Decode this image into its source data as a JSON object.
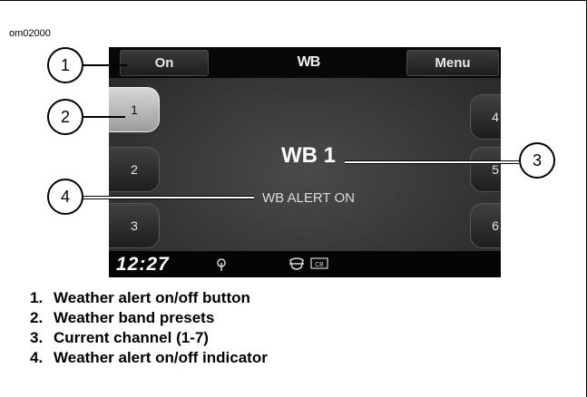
{
  "figure": {
    "id": "om02000"
  },
  "screen": {
    "on_button": "On",
    "title": "WB",
    "menu_button": "Menu",
    "presets_left": [
      {
        "label": "1",
        "active": true
      },
      {
        "label": "2",
        "active": false
      },
      {
        "label": "3",
        "active": false
      }
    ],
    "presets_right": [
      {
        "label": "4"
      },
      {
        "label": "5"
      },
      {
        "label": "6"
      }
    ],
    "channel": "WB 1",
    "alert_indicator": "WB ALERT ON",
    "status": {
      "clock": "12:27",
      "icons": [
        "antenna-icon",
        "harley-shield-icon",
        "cb-icon"
      ],
      "cb_label": "CB"
    }
  },
  "callouts": [
    "1",
    "2",
    "3",
    "4"
  ],
  "legend": [
    {
      "num": "1.",
      "text": "Weather alert on/off button"
    },
    {
      "num": "2.",
      "text": "Weather band presets"
    },
    {
      "num": "3.",
      "text": "Current channel (1-7)"
    },
    {
      "num": "4.",
      "text": "Weather alert on/off indicator"
    }
  ]
}
